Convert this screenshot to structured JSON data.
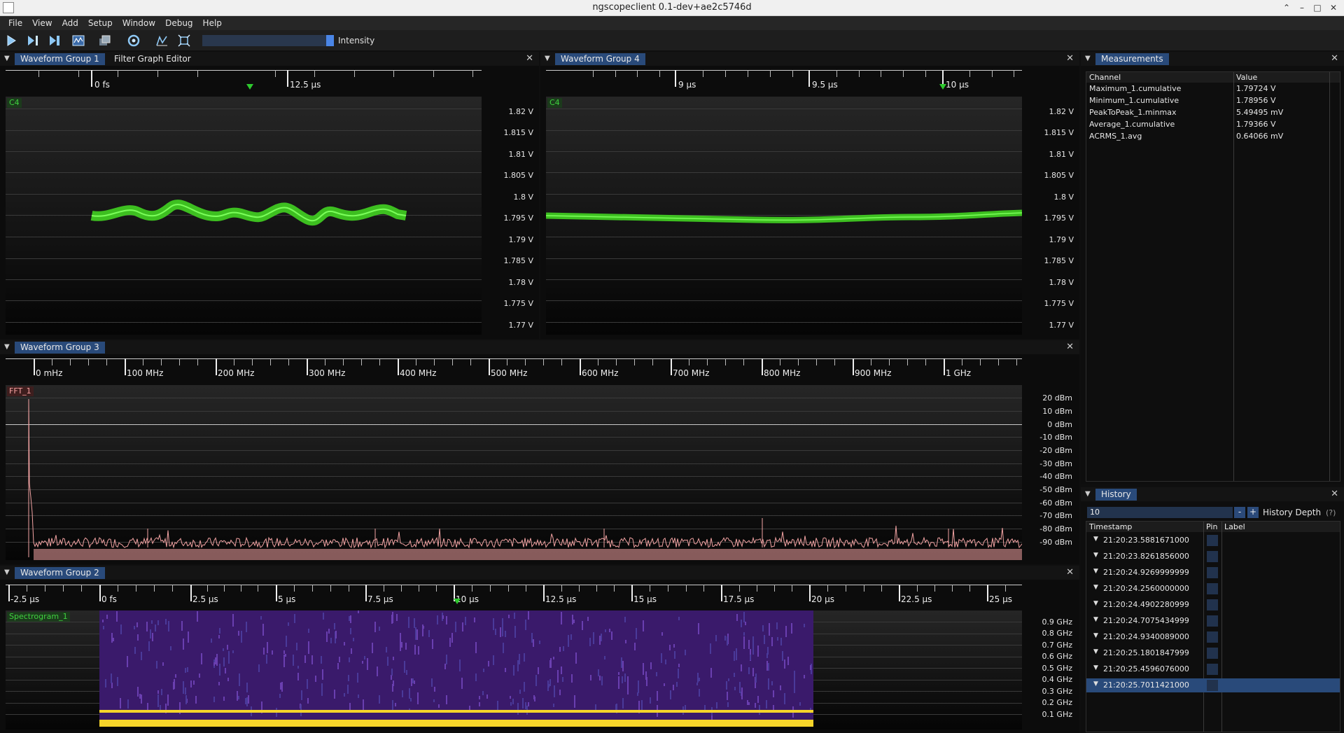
{
  "window": {
    "title": "ngscopeclient 0.1-dev+ae2c5746d",
    "controls": [
      "⌃",
      "–",
      "□",
      "✕"
    ]
  },
  "menu": [
    "File",
    "View",
    "Add",
    "Setup",
    "Window",
    "Debug",
    "Help"
  ],
  "toolbar": {
    "intensity_label": "Intensity",
    "intensity_level": 0.98
  },
  "colors": {
    "waveform": "#44dd22",
    "fft": "#f2a3a3",
    "tab_active": "#294a7a",
    "spectrogram_low": "#3a1a6b",
    "spectrogram_band": "#f5d42a"
  },
  "group1": {
    "tabs": [
      "Waveform Group 1",
      "Filter Graph Editor"
    ],
    "time_labels": [
      "0 fs",
      "12.5 µs"
    ],
    "channel": "C4",
    "y_labels": [
      "1.82 V",
      "1.815 V",
      "1.81 V",
      "1.805 V",
      "1.8 V",
      "1.795 V",
      "1.79 V",
      "1.785 V",
      "1.78 V",
      "1.775 V",
      "1.77 V"
    ]
  },
  "group4": {
    "tab": "Waveform Group 4",
    "time_labels": [
      "9 µs",
      "9.5 µs",
      "10 µs"
    ],
    "channel": "C4",
    "y_labels": [
      "1.82 V",
      "1.815 V",
      "1.81 V",
      "1.805 V",
      "1.8 V",
      "1.795 V",
      "1.79 V",
      "1.785 V",
      "1.78 V",
      "1.775 V",
      "1.77 V"
    ]
  },
  "group3": {
    "tab": "Waveform Group 3",
    "freq_labels": [
      "0 mHz",
      "100 MHz",
      "200 MHz",
      "300 MHz",
      "400 MHz",
      "500 MHz",
      "600 MHz",
      "700 MHz",
      "800 MHz",
      "900 MHz",
      "1 GHz"
    ],
    "channel": "FFT_1",
    "y_labels": [
      "20 dBm",
      "10 dBm",
      "0 dBm",
      "-10 dBm",
      "-20 dBm",
      "-30 dBm",
      "-40 dBm",
      "-50 dBm",
      "-60 dBm",
      "-70 dBm",
      "-80 dBm",
      "-90 dBm"
    ]
  },
  "group2": {
    "tab": "Waveform Group 2",
    "time_labels": [
      "-2.5 µs",
      "0 fs",
      "2.5 µs",
      "5 µs",
      "7.5 µs",
      "10 µs",
      "12.5 µs",
      "15 µs",
      "17.5 µs",
      "20 µs",
      "22.5 µs",
      "25 µs"
    ],
    "channel": "Spectrogram_1",
    "y_labels": [
      "0.9 GHz",
      "0.8 GHz",
      "0.7 GHz",
      "0.6 GHz",
      "0.5 GHz",
      "0.4 GHz",
      "0.3 GHz",
      "0.2 GHz",
      "0.1 GHz"
    ]
  },
  "measurements": {
    "tab": "Measurements",
    "columns": [
      "Channel",
      "Value"
    ],
    "rows": [
      {
        "channel": "Maximum_1.cumulative",
        "value": "1.79724 V"
      },
      {
        "channel": "Minimum_1.cumulative",
        "value": "1.78956 V"
      },
      {
        "channel": "PeakToPeak_1.minmax",
        "value": "5.49495 mV"
      },
      {
        "channel": "Average_1.cumulative",
        "value": "1.79366 V"
      },
      {
        "channel": "ACRMS_1.avg",
        "value": "0.64066 mV"
      }
    ]
  },
  "history": {
    "tab": "History",
    "depth_value": "10",
    "minus": "-",
    "plus": "+",
    "depth_label": "History Depth",
    "help": "(?)",
    "columns": [
      "Timestamp",
      "Pin",
      "Label"
    ],
    "rows": [
      "21:20:23.5881671000",
      "21:20:23.8261856000",
      "21:20:24.9269999999",
      "21:20:24.2560000000",
      "21:20:24.4902280999",
      "21:20:24.7075434999",
      "21:20:24.9340089000",
      "21:20:25.1801847999",
      "21:20:25.4596076000",
      "21:20:25.7011421000"
    ],
    "selected_index": 9
  }
}
